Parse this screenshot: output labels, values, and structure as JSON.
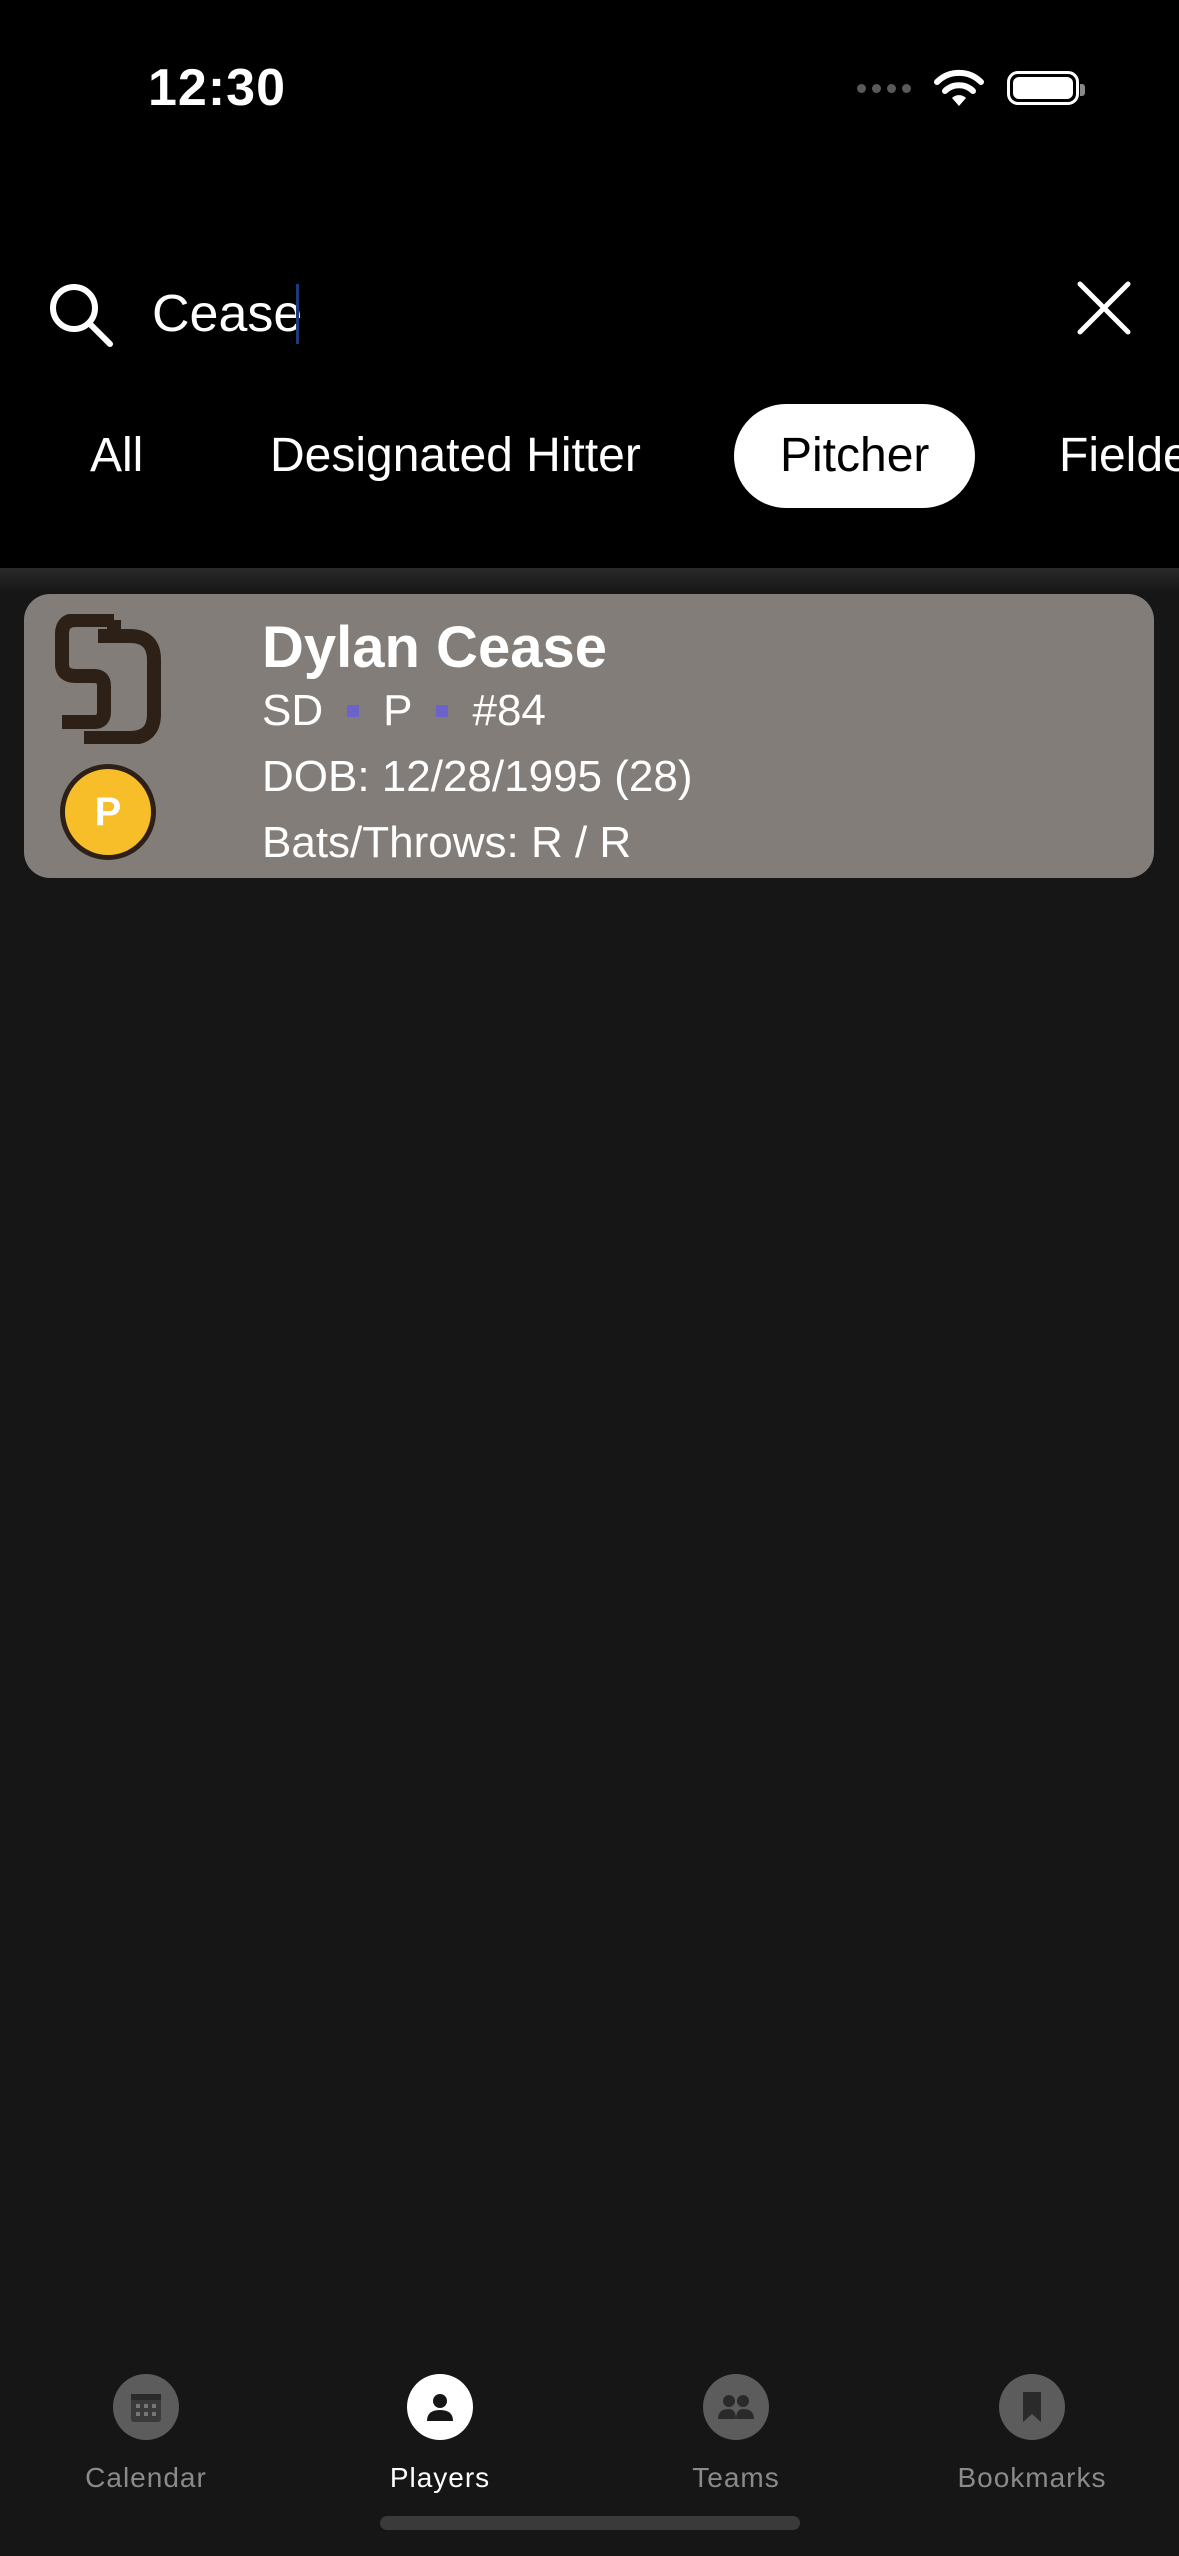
{
  "status_bar": {
    "time": "12:30"
  },
  "search": {
    "value": "Cease"
  },
  "filters": [
    {
      "label": "All"
    },
    {
      "label": "Designated Hitter"
    },
    {
      "label": "Pitcher"
    },
    {
      "label": "Fielde"
    }
  ],
  "filters_selected": "Pitcher",
  "results": [
    {
      "name": "Dylan Cease",
      "team": "SD",
      "position": "P",
      "number": "#84",
      "dob": "DOB: 12/28/1995 (28)",
      "bats_throws": "Bats/Throws: R / R",
      "badge": "P",
      "badge_color": "#f7be2a",
      "card_color": "#827d78"
    }
  ],
  "tabbar": {
    "items": [
      {
        "label": "Calendar",
        "icon": "calendar-icon"
      },
      {
        "label": "Players",
        "icon": "person-icon"
      },
      {
        "label": "Teams",
        "icon": "people-icon"
      },
      {
        "label": "Bookmarks",
        "icon": "bookmark-icon"
      }
    ],
    "selected": "Players"
  },
  "colors": {
    "accent_dot": "#6b63c9",
    "background": "#161616",
    "header": "#000000"
  }
}
